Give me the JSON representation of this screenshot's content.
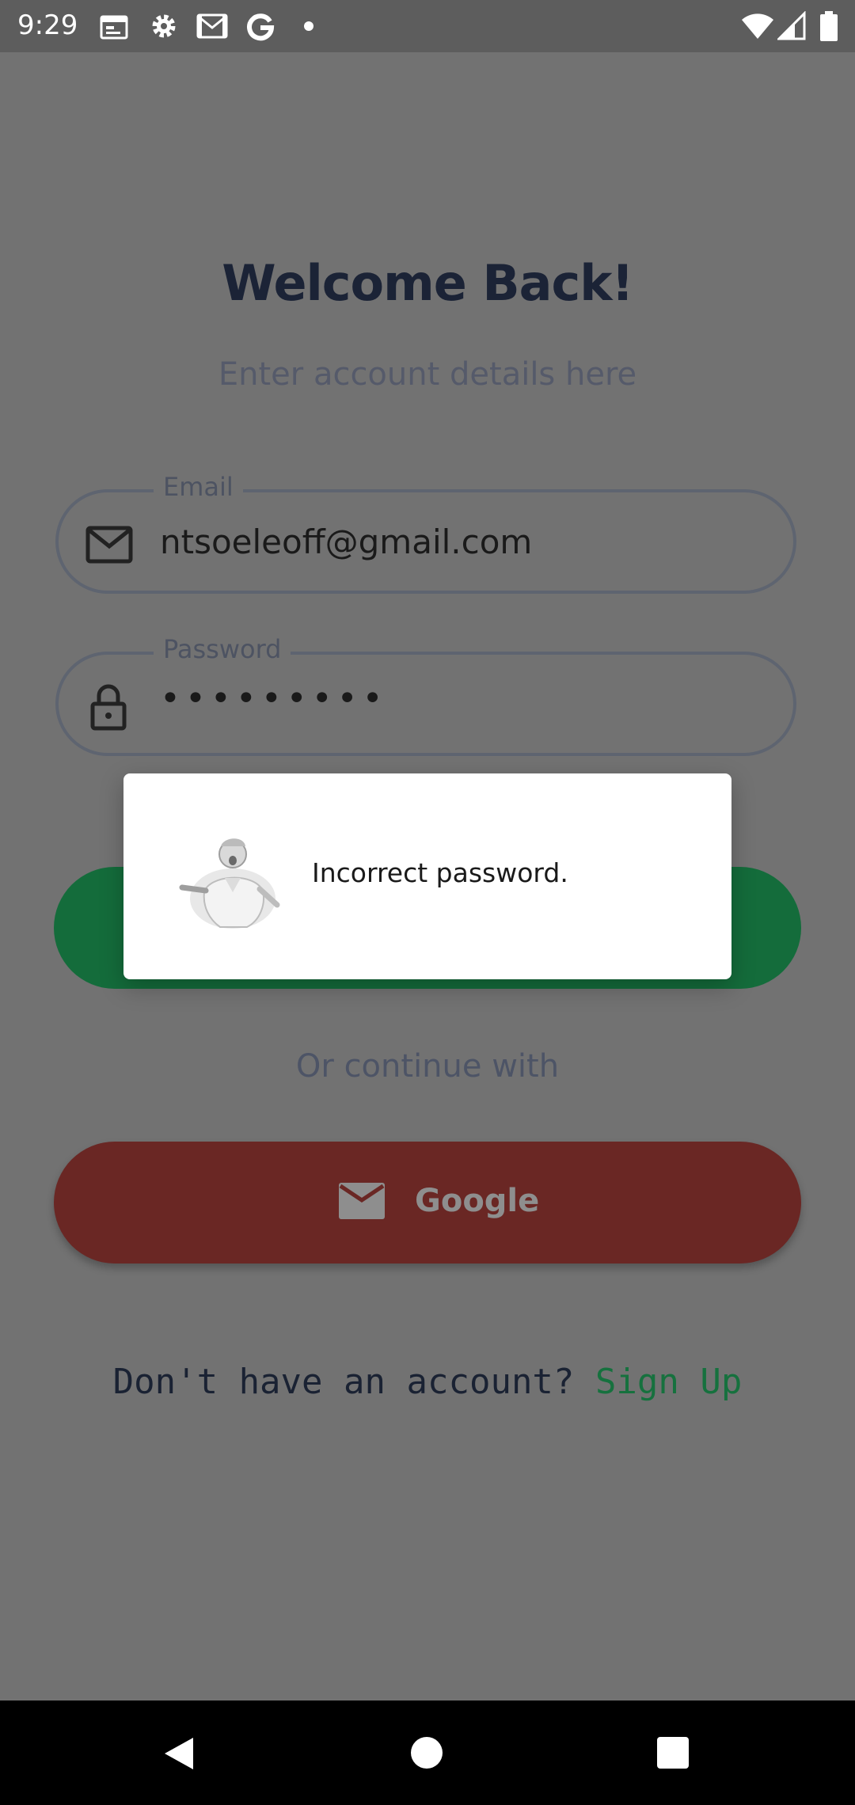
{
  "status_bar": {
    "time": "9:29",
    "left_icons": [
      "calendar-icon",
      "gear-icon",
      "gmail-icon",
      "google-icon",
      "notification-dot"
    ],
    "right_icons": [
      "wifi-icon",
      "signal-icon",
      "battery-icon"
    ]
  },
  "login": {
    "title": "Welcome Back!",
    "subtitle": "Enter account details here",
    "email": {
      "label": "Email",
      "value": "ntsoeleoff@gmail.com",
      "icon": "mail-icon"
    },
    "password": {
      "label": "Password",
      "value": "•••••••••",
      "icon": "lock-icon"
    },
    "login_button_color": "#146c3b",
    "divider_text": "Or continue with",
    "google_button": {
      "label": "Google",
      "icon": "mail-icon",
      "color": "#6a2724"
    },
    "signup_prompt": "Don't have an account?",
    "signup_link": "Sign Up"
  },
  "dialog": {
    "message": "Incorrect password.",
    "image": "chef-figure-image"
  },
  "nav_bar": {
    "buttons": [
      "back-button",
      "home-button",
      "recents-button"
    ]
  }
}
